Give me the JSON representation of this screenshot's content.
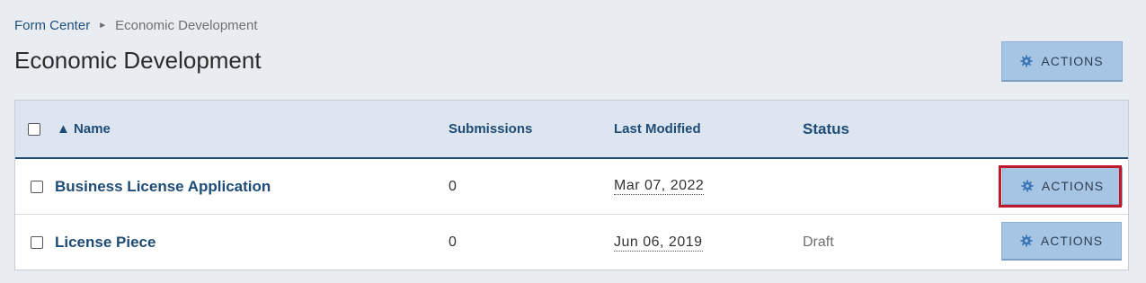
{
  "breadcrumb": {
    "root": "Form Center",
    "separator": "►",
    "current": "Economic Development"
  },
  "page_title": "Economic Development",
  "top_actions_label": "ACTIONS",
  "table": {
    "columns": {
      "name": "▲ Name",
      "submissions": "Submissions",
      "last_modified": "Last Modified",
      "status": "Status"
    },
    "rows": [
      {
        "name": "Business License Application",
        "submissions": "0",
        "last_modified": "Mar 07, 2022",
        "status": "",
        "actions_label": "ACTIONS"
      },
      {
        "name": "License Piece",
        "submissions": "0",
        "last_modified": "Jun 06, 2019",
        "status": "Draft",
        "actions_label": "ACTIONS"
      }
    ]
  },
  "icons": {
    "actions_icon": "gear-icon"
  },
  "colors": {
    "accent": "#1e4c77",
    "button_bg": "#a6c4e4",
    "highlight": "#c1192c"
  }
}
